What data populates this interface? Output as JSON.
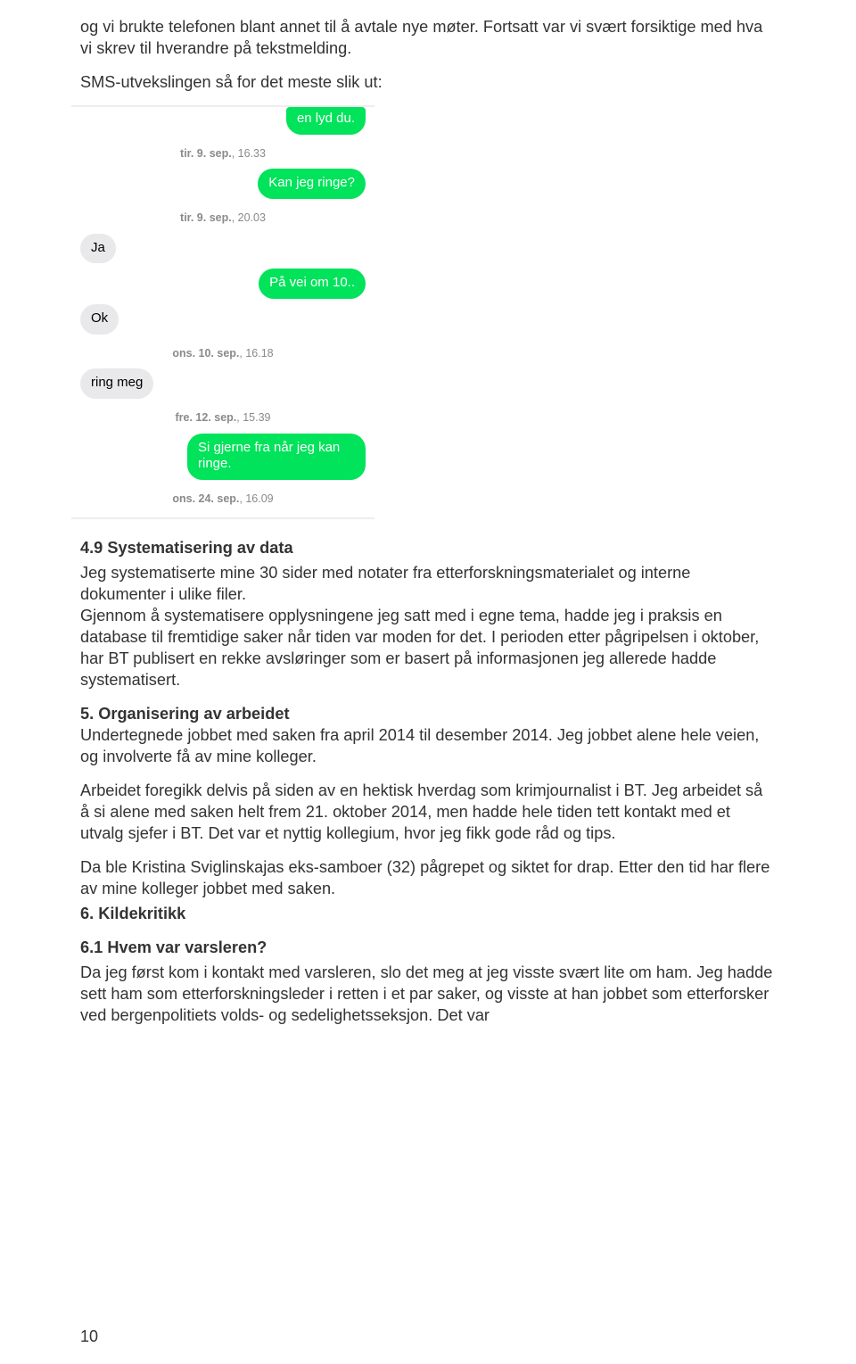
{
  "intro": {
    "p1": "og vi brukte telefonen blant annet til å avtale nye møter. Fortsatt var vi svært forsiktige med hva vi skrev til hverandre på tekstmelding.",
    "p2": "SMS-utvekslingen så for det meste slik ut:"
  },
  "sms": {
    "cut_msg": "en lyd du.",
    "ts1_bold": "tir. 9. sep.",
    "ts1_rest": ", 16.33",
    "m_out1": "Kan jeg ringe?",
    "ts2_bold": "tir. 9. sep.",
    "ts2_rest": ", 20.03",
    "m_in1": "Ja",
    "m_out2": "På vei om 10..",
    "m_in2": "Ok",
    "ts3_bold": "ons. 10. sep.",
    "ts3_rest": ", 16.18",
    "m_in3": "ring meg",
    "ts4_bold": "fre. 12. sep.",
    "ts4_rest": ", 15.39",
    "m_out3": "Si gjerne fra når jeg kan ringe.",
    "ts5_bold": "ons. 24. sep.",
    "ts5_rest": ", 16.09"
  },
  "section49": {
    "heading": "4.9 Systematisering av data",
    "body": "Jeg systematiserte mine 30 sider med notater fra etterforskningsmaterialet og interne dokumenter i ulike filer.\nGjennom å systematisere opplysningene jeg satt med i egne tema, hadde jeg i praksis en database til fremtidige saker når tiden var moden for det. I perioden etter pågripelsen i oktober, har BT publisert en rekke avsløringer som er basert på informasjonen jeg allerede hadde systematisert."
  },
  "section5": {
    "heading": "5. Organisering av arbeidet",
    "line1_rest": "Undertegnede jobbet med saken fra april 2014 til desember 2014. Jeg jobbet alene hele veien, og involverte få av mine kolleger.",
    "p2": "Arbeidet foregikk delvis på siden av en hektisk hverdag som krimjournalist i BT. Jeg arbeidet så å si alene med saken helt frem 21. oktober 2014, men hadde hele tiden tett kontakt med et utvalg sjefer i BT. Det var et nyttig kollegium, hvor jeg fikk gode råd og tips.",
    "p3": "Da ble Kristina Sviglinskajas eks-samboer (32) pågrepet og siktet for drap. Etter den tid har flere av mine kolleger jobbet med saken."
  },
  "section6": {
    "heading": "6. Kildekritikk"
  },
  "section61": {
    "heading": "6.1 Hvem var varsleren?",
    "body": "Da jeg først kom i kontakt med varsleren, slo det meg at jeg visste svært lite om ham. Jeg hadde sett ham som etterforskningsleder i retten i et par saker, og visste at han jobbet som etterforsker ved bergenpolitiets volds- og sedelighetsseksjon. Det var"
  },
  "pagenum": "10"
}
